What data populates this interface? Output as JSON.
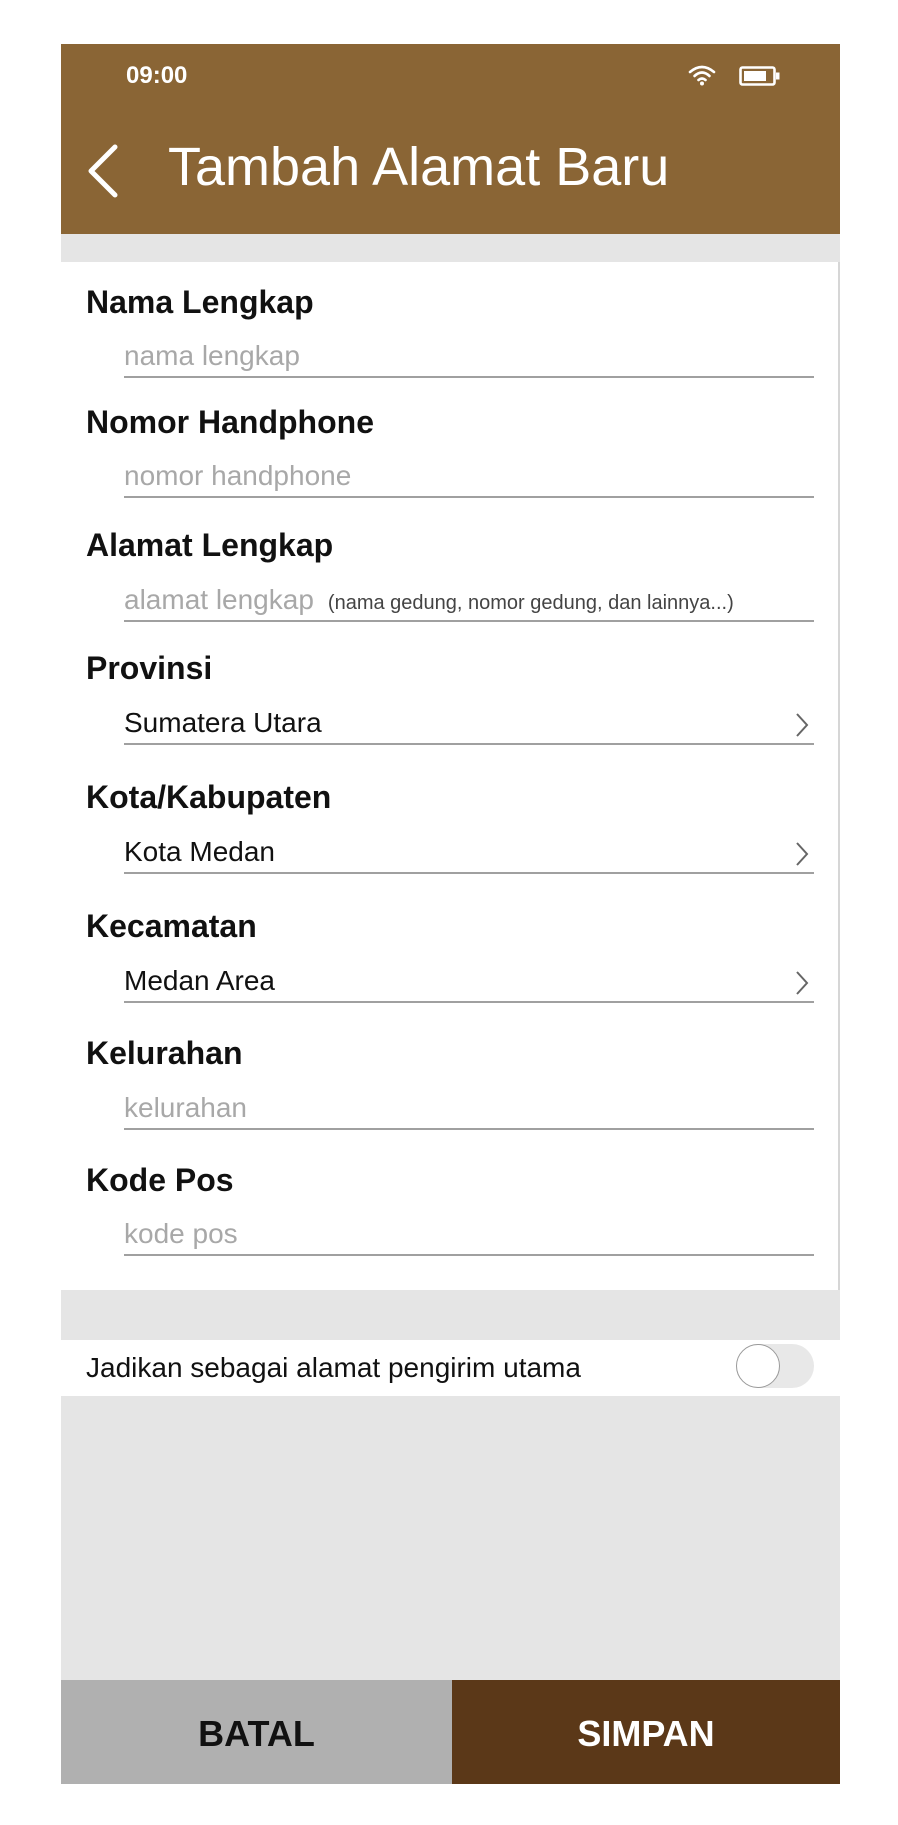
{
  "status_bar": {
    "time": "09:00"
  },
  "header": {
    "title": "Tambah Alamat Baru"
  },
  "form": {
    "fields": [
      {
        "label": "Nama Lengkap",
        "placeholder": "nama lengkap",
        "value": ""
      },
      {
        "label": "Nomor Handphone",
        "placeholder": "nomor handphone",
        "value": ""
      },
      {
        "label": "Alamat Lengkap",
        "placeholder": "alamat lengkap",
        "hint": "(nama gedung, nomor gedung, dan lainnya...)",
        "value": ""
      },
      {
        "label": "Provinsi",
        "value": "Sumatera Utara"
      },
      {
        "label": "Kota/Kabupaten",
        "value": "Kota Medan"
      },
      {
        "label": "Kecamatan",
        "value": "Medan Area"
      },
      {
        "label": "Kelurahan",
        "placeholder": "kelurahan",
        "value": ""
      },
      {
        "label": "Kode Pos",
        "placeholder": "kode pos",
        "value": ""
      }
    ]
  },
  "default_address": {
    "label": "Jadikan sebagai alamat pengirim utama",
    "enabled": false
  },
  "buttons": {
    "cancel": "BATAL",
    "save": "SIMPAN"
  },
  "colors": {
    "header": "#8a6535",
    "save_button": "#5b3818",
    "cancel_button": "#b0b0b0",
    "background": "#e5e5e5"
  }
}
